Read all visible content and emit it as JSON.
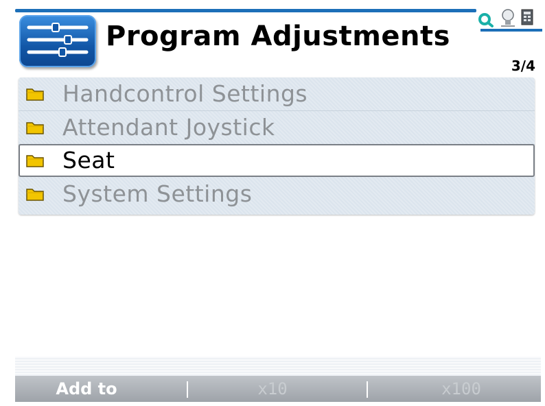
{
  "header": {
    "title": "Program Adjustments",
    "page_counter": "3/4",
    "app_icon": "sliders-icon",
    "status_icons": [
      "search-icon",
      "bulb-icon",
      "battery-icon"
    ]
  },
  "menu": {
    "items": [
      {
        "label": "Handcontrol Settings",
        "icon": "folder-icon",
        "selected": false
      },
      {
        "label": "Attendant Joystick",
        "icon": "folder-icon",
        "selected": false
      },
      {
        "label": "Seat",
        "icon": "folder-icon",
        "selected": true
      },
      {
        "label": "System Settings",
        "icon": "folder-icon",
        "selected": false
      }
    ]
  },
  "softkeys": {
    "left": "Add to",
    "middle": "x10",
    "right": "x100"
  },
  "colors": {
    "accent": "#1c6fb8",
    "folder": "#f2c500",
    "inactive_text": "#8e9296"
  }
}
